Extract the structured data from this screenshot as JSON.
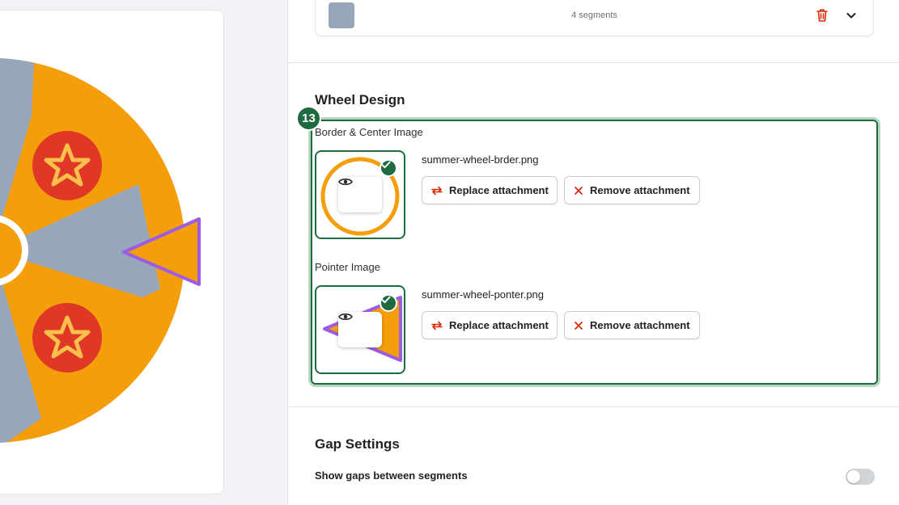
{
  "segments_summary": {
    "count_text": "4 segments",
    "swatch_color": "#97a6bb"
  },
  "wheel_design": {
    "title": "Wheel Design",
    "step_number": "13",
    "border_center": {
      "label": "Border & Center Image",
      "filename": "summer-wheel-brder.png",
      "replace_label": "Replace attachment",
      "remove_label": "Remove attachment"
    },
    "pointer": {
      "label": "Pointer Image",
      "filename": "summer-wheel-ponter.png",
      "replace_label": "Replace attachment",
      "remove_label": "Remove attachment"
    }
  },
  "gap_settings": {
    "title": "Gap Settings",
    "toggle_label": "Show gaps between segments",
    "toggle_on": false
  },
  "colors": {
    "wheel_orange": "#f59e0b",
    "segment_gray": "#97a6bb",
    "star_red": "#e03826",
    "star_gold": "#fbbf4c",
    "pointer_purple": "#9b5de5",
    "accent_green": "#1f6b3f",
    "danger_red": "#d82c0d"
  },
  "icons": [
    "trash-icon",
    "chevron-down-icon",
    "eye-icon",
    "check-icon",
    "replace-icon",
    "close-icon"
  ]
}
